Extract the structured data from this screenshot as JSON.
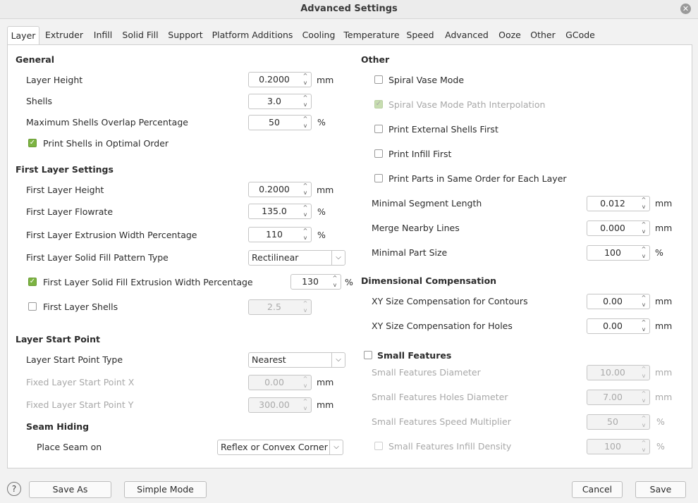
{
  "window": {
    "title": "Advanced Settings"
  },
  "tabs": [
    "Layer",
    "Extruder",
    "Infill",
    "Solid Fill",
    "Support",
    "Platform Additions",
    "Cooling",
    "Temperature",
    "Speed",
    "Advanced",
    "Ooze",
    "Other",
    "GCode"
  ],
  "general": {
    "title": "General",
    "layer_height": {
      "label": "Layer Height",
      "value": "0.2000",
      "unit": "mm"
    },
    "shells": {
      "label": "Shells",
      "value": "3.0"
    },
    "max_shells_overlap": {
      "label": "Maximum Shells Overlap Percentage",
      "value": "50",
      "unit": "%"
    },
    "print_shells_optimal": {
      "label": "Print Shells in Optimal Order",
      "checked": true
    }
  },
  "first_layer": {
    "title": "First Layer Settings",
    "height": {
      "label": "First Layer Height",
      "value": "0.2000",
      "unit": "mm"
    },
    "flowrate": {
      "label": "First Layer Flowrate",
      "value": "135.0",
      "unit": "%"
    },
    "extrusion_width": {
      "label": "First Layer Extrusion Width Percentage",
      "value": "110",
      "unit": "%"
    },
    "solid_fill_pattern": {
      "label": "First Layer Solid Fill Pattern Type",
      "value": "Rectilinear"
    },
    "solid_fill_width": {
      "label": "First Layer Solid Fill Extrusion Width Percentage",
      "value": "130",
      "unit": "%",
      "checked": true
    },
    "shells": {
      "label": "First Layer Shells",
      "value": "2.5",
      "checked": false
    }
  },
  "start_point": {
    "title": "Layer Start Point",
    "type": {
      "label": "Layer Start Point Type",
      "value": "Nearest"
    },
    "fixed_x": {
      "label": "Fixed Layer Start Point X",
      "value": "0.00",
      "unit": "mm"
    },
    "fixed_y": {
      "label": "Fixed Layer Start Point Y",
      "value": "300.00",
      "unit": "mm"
    },
    "seam_title": "Seam Hiding",
    "place_seam": {
      "label": "Place Seam on",
      "value": "Reflex or Convex Corner"
    }
  },
  "other": {
    "title": "Other",
    "spiral_vase": {
      "label": "Spiral Vase Mode",
      "checked": false
    },
    "spiral_interp": {
      "label": "Spiral Vase Mode Path Interpolation",
      "checked": true
    },
    "external_first": {
      "label": "Print External Shells First",
      "checked": false
    },
    "infill_first": {
      "label": "Print Infill First",
      "checked": false
    },
    "same_order": {
      "label": "Print Parts in Same Order for Each Layer",
      "checked": false
    },
    "min_segment": {
      "label": "Minimal Segment Length",
      "value": "0.012",
      "unit": "mm"
    },
    "merge_lines": {
      "label": "Merge Nearby Lines",
      "value": "0.000",
      "unit": "mm"
    },
    "min_part": {
      "label": "Minimal Part Size",
      "value": "100",
      "unit": "%"
    }
  },
  "dimensional": {
    "title": "Dimensional Compensation",
    "xy_contours": {
      "label": "XY Size Compensation for Contours",
      "value": "0.00",
      "unit": "mm"
    },
    "xy_holes": {
      "label": "XY Size Compensation for Holes",
      "value": "0.00",
      "unit": "mm"
    }
  },
  "small_features": {
    "title": "Small Features",
    "checked": false,
    "diameter": {
      "label": "Small Features Diameter",
      "value": "10.00",
      "unit": "mm"
    },
    "holes_diameter": {
      "label": "Small Features Holes Diameter",
      "value": "7.00",
      "unit": "mm"
    },
    "speed_mult": {
      "label": "Small Features Speed Multiplier",
      "value": "50",
      "unit": "%"
    },
    "infill_density": {
      "label": "Small Features Infill Density",
      "value": "100",
      "unit": "%",
      "checked": false
    }
  },
  "footer": {
    "help": "?",
    "save_as": "Save As",
    "simple_mode": "Simple Mode",
    "cancel": "Cancel",
    "save": "Save"
  },
  "colors": {
    "accent_check": "#7cb342",
    "panel_bg": "#ffffff",
    "window_bg": "#f2f2f2"
  }
}
